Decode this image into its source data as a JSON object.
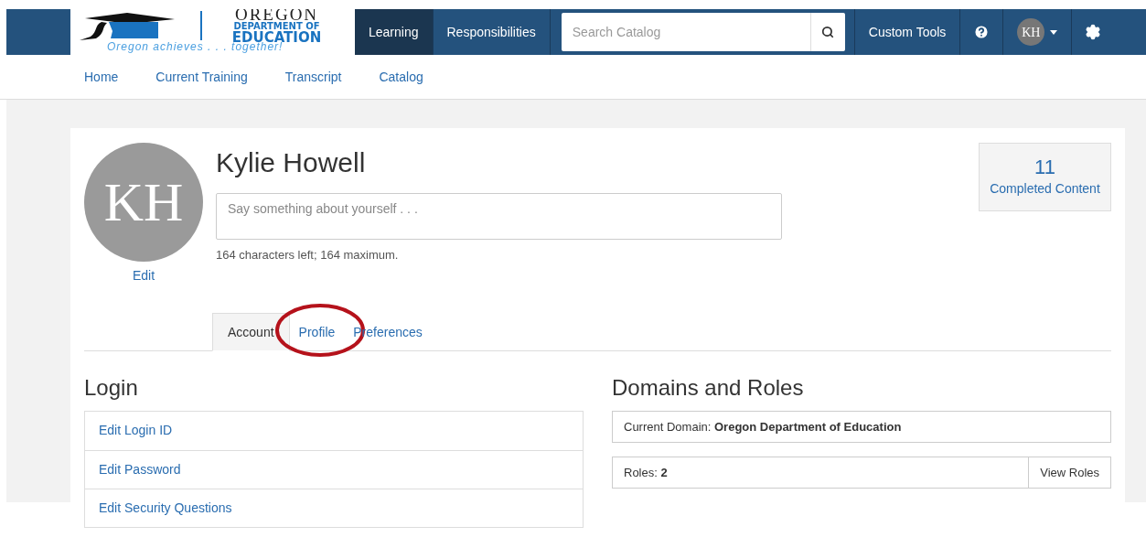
{
  "logo": {
    "title": "OREGON",
    "line1": "DEPARTMENT OF",
    "line2": "EDUCATION",
    "tagline": "Oregon achieves . . . together!"
  },
  "nav": [
    {
      "label": "Learning",
      "selected": true
    },
    {
      "label": "Responsibilities",
      "selected": false
    }
  ],
  "search": {
    "placeholder": "Search Catalog"
  },
  "tools": {
    "label": "Custom Tools"
  },
  "user": {
    "initials": "KH"
  },
  "subnav": [
    "Home",
    "Current Training",
    "Transcript",
    "Catalog"
  ],
  "profile": {
    "initials": "KH",
    "edit": "Edit",
    "name": "Kylie Howell",
    "about_placeholder": "Say something about yourself . . .",
    "hint": "164 characters left; 164 maximum.",
    "stat_value": "11",
    "stat_label": "Completed Content"
  },
  "tabs": [
    {
      "label": "Account",
      "selected": true,
      "circled": false
    },
    {
      "label": "Profile",
      "selected": false,
      "circled": true
    },
    {
      "label": "Preferences",
      "selected": false,
      "circled": false
    }
  ],
  "login": {
    "title": "Login",
    "links": [
      "Edit Login ID",
      "Edit Password",
      "Edit Security Questions"
    ]
  },
  "domains": {
    "title": "Domains and Roles",
    "current_domain": "Current Domain: **Oregon Department of Education**",
    "roles": "Roles: **2**",
    "view_button": "View Roles"
  }
}
